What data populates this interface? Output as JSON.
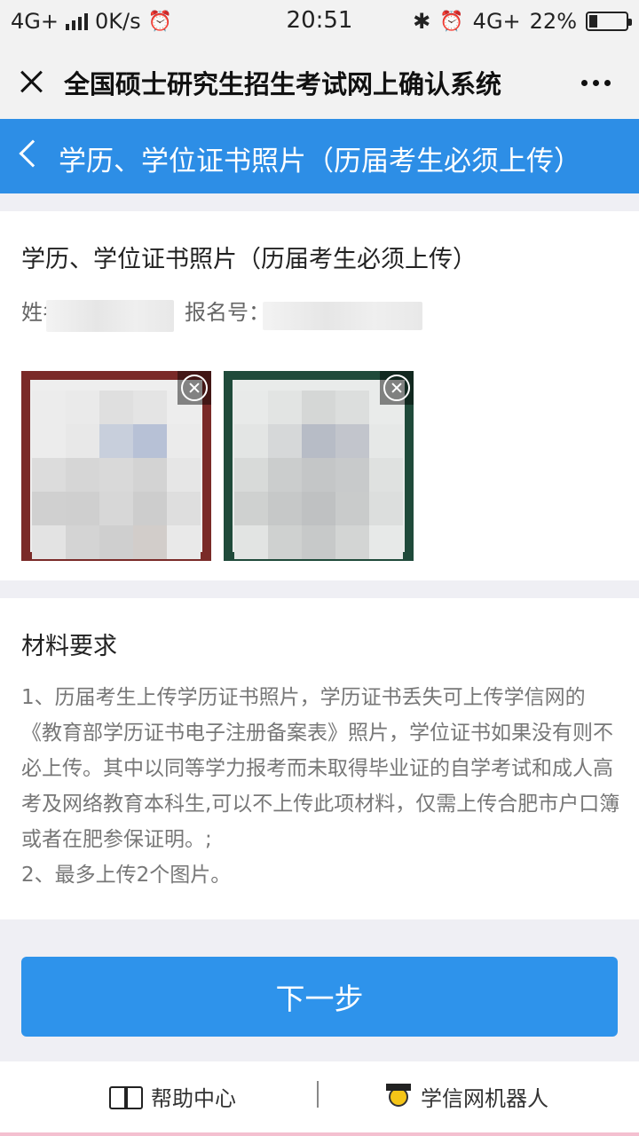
{
  "status_bar": {
    "network_left": "4G+",
    "speed": "0K/s",
    "time": "20:51",
    "network_right": "4G+",
    "battery_percent": "22%",
    "battery_level": 0.22
  },
  "title_bar": {
    "title": "全国硕士研究生招生考试网上确认系统"
  },
  "header": {
    "title": "学历、学位证书照片（历届考生必须上传）"
  },
  "upload_section": {
    "title": "学历、学位证书照片（历届考生必须上传）",
    "name_label": "姓名：",
    "reg_label": "报名号："
  },
  "photos": [
    {
      "label": "certificate-photo-1",
      "border_color": "#7a2a28"
    },
    {
      "label": "certificate-photo-2",
      "border_color": "#1f4a3a"
    }
  ],
  "requirements": {
    "title": "材料要求",
    "text": "1、历届考生上传学历证书照片，学历证书丢失可上传学信网的《教育部学历证书电子注册备案表》照片，学位证书如果没有则不必上传。其中以同等学力报考而未取得毕业证的自学考试和成人高考及网络教育本科生,可以不上传此项材料，仅需上传合肥市户口簿或者在肥参保证明。;",
    "text2": "2、最多上传2个图片。"
  },
  "buttons": {
    "next": "下一步"
  },
  "bottom_bar": {
    "help": "帮助中心",
    "robot": "学信网机器人"
  },
  "colors": {
    "primary": "#2e93eb",
    "header": "#2d8ee6"
  }
}
